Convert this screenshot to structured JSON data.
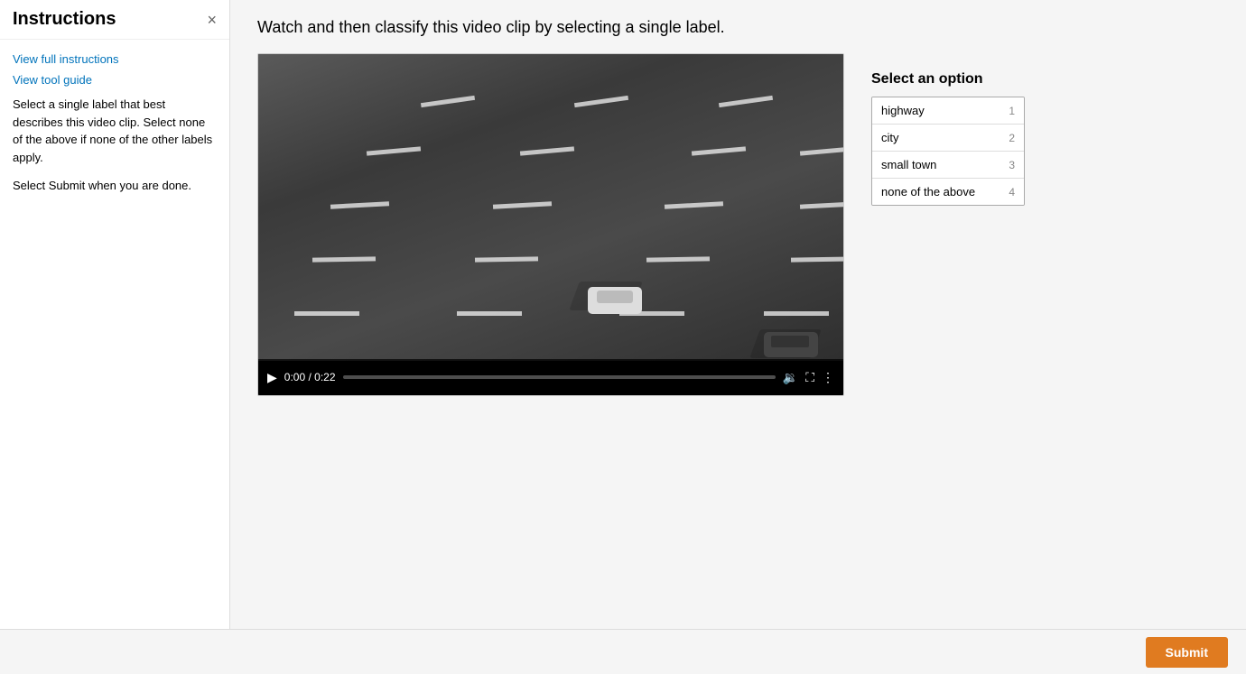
{
  "sidebar": {
    "title": "Instructions",
    "close_label": "×",
    "link_instructions": "View full instructions",
    "link_tool_guide": "View tool guide",
    "body_text_1": "Select a single label that best describes this video clip. Select none of the above if none of the other labels apply.",
    "body_text_2": "Select Submit when you are done."
  },
  "main": {
    "instruction": "Watch and then classify this video clip by selecting a single label.",
    "video": {
      "time_current": "0:00",
      "time_total": "0:22",
      "time_display": "0:00 / 0:22"
    }
  },
  "options": {
    "heading": "Select an option",
    "items": [
      {
        "label": "highway",
        "num": "1"
      },
      {
        "label": "city",
        "num": "2"
      },
      {
        "label": "small town",
        "num": "3"
      },
      {
        "label": "none of the above",
        "num": "4"
      }
    ]
  },
  "footer": {
    "submit_label": "Submit"
  }
}
